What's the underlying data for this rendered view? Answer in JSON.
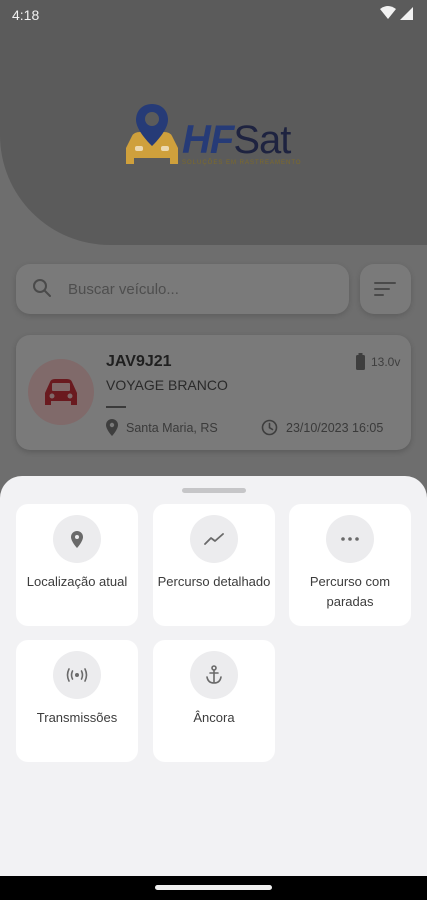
{
  "status_bar": {
    "time": "4:18"
  },
  "logo": {
    "hf": "HF",
    "sat": "Sat",
    "tagline": "SOLUÇÕES EM RASTREAMENTO"
  },
  "search": {
    "placeholder": "Buscar veículo..."
  },
  "vehicle": {
    "plate": "JAV9J21",
    "model": "VOYAGE BRANCO",
    "voltage": "13.0v",
    "location": "Santa Maria, RS",
    "datetime": "23/10/2023 16:05",
    "icon": "car-icon",
    "icon_color": "#6a1a1f"
  },
  "actions": [
    {
      "label": "Localização atual",
      "icon": "location-pin-icon"
    },
    {
      "label": "Percurso detalhado",
      "icon": "trend-line-icon"
    },
    {
      "label": "Percurso com paradas",
      "icon": "more-dots-icon"
    },
    {
      "label": "Transmissões",
      "icon": "broadcast-icon"
    },
    {
      "label": "Âncora",
      "icon": "anchor-icon"
    }
  ],
  "colors": {
    "brand_blue": "#263b77",
    "brand_gold": "#f5b731",
    "overlay": "#6e6e6e",
    "sheet": "#f2f2f4"
  }
}
